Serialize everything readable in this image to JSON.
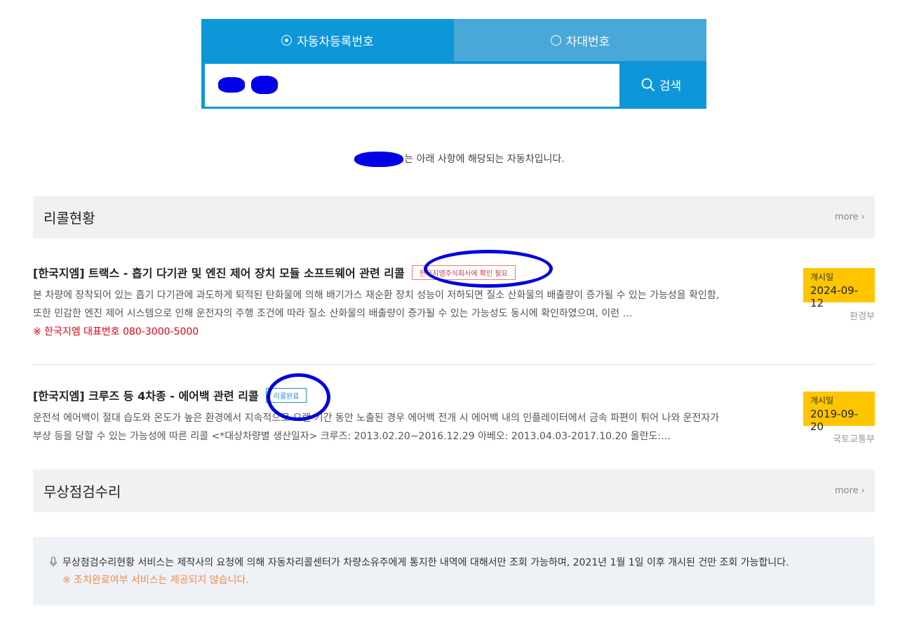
{
  "search": {
    "tabs": [
      {
        "label": "자동차등록번호",
        "selected": true
      },
      {
        "label": "차대번호",
        "selected": false
      }
    ],
    "button_label": "검색",
    "colors": {
      "tab_active": "#0d97d9",
      "tab_inactive": "#4aa8d8"
    }
  },
  "result_intro": {
    "suffix_text": "는 아래 사항에 해당되는 자동차입니다."
  },
  "recall_section": {
    "title": "리콜현황",
    "more_label": "more ›",
    "items": [
      {
        "title": "[한국지엠] 트랙스 - 흡기 다기관 및 엔진 제어 장치 모듈 소프트웨어 관련 리콜",
        "status_badge": "한국지엠주식회사에 확인 필요",
        "description": "본 차량에 장착되어 있는 흡기 다기관에 과도하게 퇴적된 탄화물에 의해 배기가스 재순환 장치 성능이 저하되면 질소 산화물의 배출량이 증가될 수 있는 가능성을 확인함, 또한 민감한 엔진 제어 시스템으로 인해 운전자의 주행 조건에 따라 질소 산화물의 배출량이 증가될 수 있는 가능성도 동시에 확인하였으며, 이런 …",
        "note": "※ 한국지엠 대표번호 080-3000-5000",
        "date_label": "개시일",
        "date": "2024-09-12",
        "agency": "환경부"
      },
      {
        "title": "[한국지엠] 크루즈 등 4차종 - 에어백 관련 리콜",
        "status_badge": "리콜완료",
        "description": "운전석 에어백이 절대 습도와 온도가 높은 환경에서 지속적으로 오랜 기간 동안 노출된 경우 에어백 전개 시 에어백 내의 인플레이터에서 금속 파편이 튀어 나와 운전자가 부상 등을 당할 수 있는 가능성에 따른 리콜 <*대상차량별 생산일자> 크루즈: 2013.02.20~2016.12.29 아베오: 2013.04.03-2017.10.20 올란도:…",
        "note": "",
        "date_label": "개시일",
        "date": "2019-09-20",
        "agency": "국토교통부"
      }
    ]
  },
  "free_repair_section": {
    "title": "무상점검수리",
    "more_label": "more ›"
  },
  "notice": {
    "text": "무상점검수리현황 서비스는 제작사의 요청에 의해 자동차리콜센터가 차량소유주에게 통지한 내역에 대해서만 조회 가능하며, 2021년 1월 1일 이후 개시된 건만 조회 가능합니다.",
    "sub_text": "※ 조치완료여부 서비스는 제공되지 않습니다."
  },
  "colors": {
    "date_box": "#fec500",
    "note_red": "#e60012",
    "notice_orange": "#f28a4b",
    "annotation_blue": "#0000e0"
  }
}
